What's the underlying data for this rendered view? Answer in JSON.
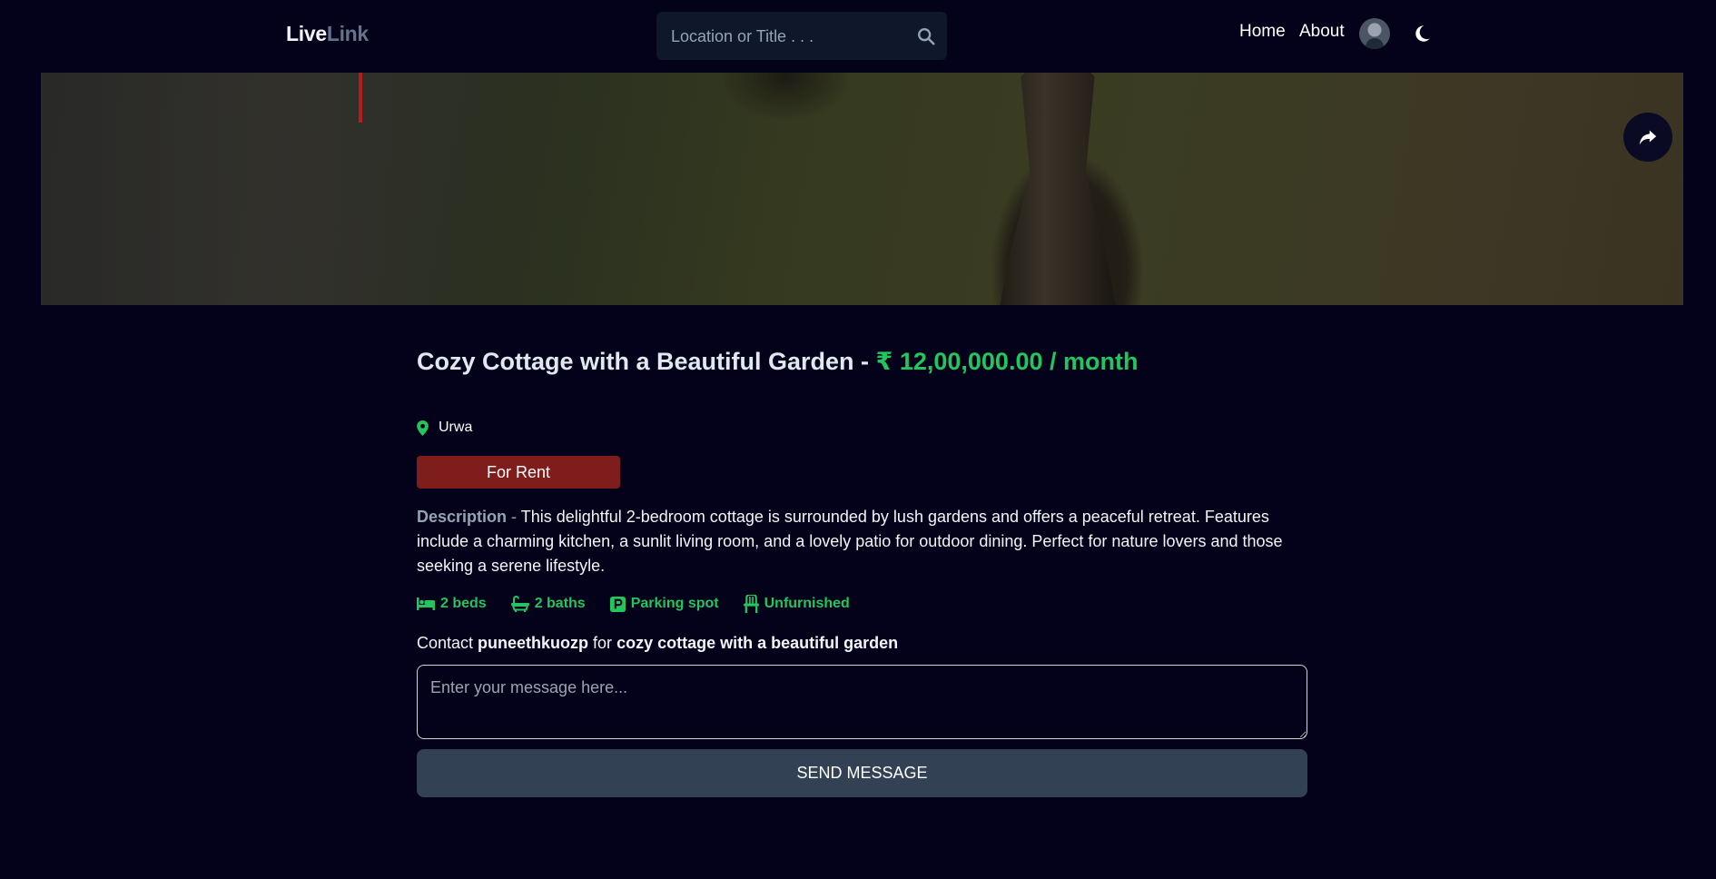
{
  "header": {
    "logo_part1": "Live",
    "logo_part2": "Link",
    "search_placeholder": "Location or Title . . .",
    "nav": {
      "home": "Home",
      "about": "About"
    }
  },
  "listing": {
    "title": "Cozy Cottage with a Beautiful Garden",
    "separator": " - ",
    "price": "₹ 12,00,000.00 / month",
    "location": "Urwa",
    "type_badge": "For Rent",
    "description_label": "Description",
    "description_sep": " - ",
    "description": "This delightful 2-bedroom cottage is surrounded by lush gardens and offers a peaceful retreat. Features include a charming kitchen, a sunlit living room, and a lovely patio for outdoor dining. Perfect for nature lovers and those seeking a serene lifestyle.",
    "features": {
      "beds": "2 beds",
      "baths": "2 baths",
      "parking": "Parking spot",
      "furnished": "Unfurnished"
    }
  },
  "contact": {
    "prefix": "Contact ",
    "owner": "puneethkuozp",
    "mid": " for ",
    "listing_name": "cozy cottage with a beautiful garden",
    "message_placeholder": "Enter your message here...",
    "send_label": "SEND MESSAGE"
  },
  "colors": {
    "background": "#04021a",
    "accent_green": "#22c55e",
    "badge_red": "#7f1d1d",
    "button_slate": "#334155"
  },
  "icons": [
    "search-icon",
    "moon-icon",
    "share-icon",
    "location-pin-icon",
    "bed-icon",
    "bath-icon",
    "parking-icon",
    "chair-icon"
  ]
}
